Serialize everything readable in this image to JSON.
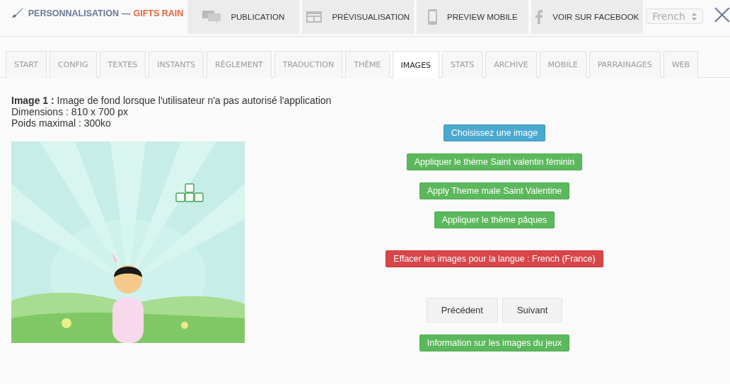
{
  "header": {
    "title": "PERSONNALISATION",
    "separator": "—",
    "game": "GIFTS RAIN",
    "actions": [
      {
        "label": "PUBLICATION"
      },
      {
        "label": "PRÉVISUALISATION"
      },
      {
        "label": "PREVIEW MOBILE"
      },
      {
        "label": "VOIR SUR FACEBOOK"
      }
    ],
    "language": "French"
  },
  "tabs": [
    {
      "label": "START",
      "selected": false
    },
    {
      "label": "CONFIG",
      "selected": false
    },
    {
      "label": "TEXTES",
      "selected": false
    },
    {
      "label": "INSTANTS",
      "selected": false
    },
    {
      "label": "RÈGLEMENT",
      "selected": false
    },
    {
      "label": "TRADUCTION",
      "selected": false
    },
    {
      "label": "THÈME",
      "selected": false
    },
    {
      "label": "IMAGES",
      "selected": true
    },
    {
      "label": "STATS",
      "selected": false
    },
    {
      "label": "ARCHIVE",
      "selected": false
    },
    {
      "label": "MOBILE",
      "selected": false
    },
    {
      "label": "PARRAINAGES",
      "selected": false
    },
    {
      "label": "WEB",
      "selected": false
    }
  ],
  "image_info": [
    "**Image 1 :** Image de fond lorsque l'utilisateur n'a pas autorisé l'application",
    "Dimensions : 810 x 700 px",
    "Poids maximal : 300ko"
  ],
  "preview": {
    "kind": "picture"
  },
  "buttons": [
    {
      "label": "Choisissez une image",
      "kind": "info"
    },
    {
      "label": "Appliquer le thème Saint valentin féminin",
      "kind": "success"
    },
    {
      "label": "Apply Theme male Saint Valentine",
      "kind": "success"
    },
    {
      "label": "Appliquer le thème pâques",
      "kind": "success"
    },
    {
      "label": "Effacer les images pour la langue : French (France)",
      "kind": "danger"
    }
  ],
  "nav": [
    "Précédent",
    "Suivant"
  ],
  "info_button": {
    "label": "Information sur les images du jeux",
    "kind": "success"
  }
}
